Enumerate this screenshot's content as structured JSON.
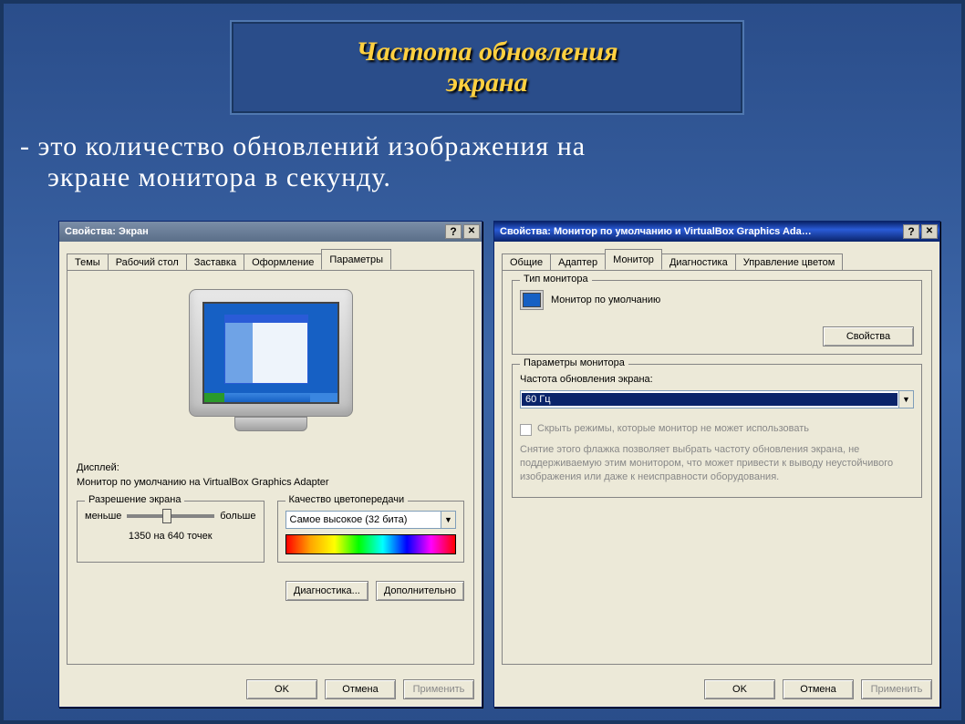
{
  "slide": {
    "title_line1": "Частота обновления",
    "title_line2": "экрана",
    "definition_prefix": "- это количество обновлений изображения на",
    "definition_line2": "экране монитора в секунду."
  },
  "win1": {
    "title": "Свойства: Экран",
    "tabs": [
      "Темы",
      "Рабочий стол",
      "Заставка",
      "Оформление",
      "Параметры"
    ],
    "active_tab": "Параметры",
    "display_label": "Дисплей:",
    "display_value": "Монитор по умолчанию на VirtualBox Graphics Adapter",
    "resolution_group": "Разрешение экрана",
    "res_less": "меньше",
    "res_more": "больше",
    "res_value": "1350 на 640 точек",
    "quality_group": "Качество цветопередачи",
    "quality_value": "Самое высокое (32 бита)",
    "btn_diag": "Диагностика...",
    "btn_more": "Дополнительно",
    "btn_ok": "OK",
    "btn_cancel": "Отмена",
    "btn_apply": "Применить"
  },
  "win2": {
    "title": "Свойства: Монитор по умолчанию и VirtualBox Graphics Ada…",
    "tabs": [
      "Общие",
      "Адаптер",
      "Монитор",
      "Диагностика",
      "Управление цветом"
    ],
    "active_tab": "Монитор",
    "montype_group": "Тип монитора",
    "montype_value": "Монитор по умолчанию",
    "btn_props": "Свойства",
    "monparams_group": "Параметры монитора",
    "freq_label": "Частота обновления экрана:",
    "freq_value": "60 Гц",
    "hide_modes": "Скрыть режимы, которые монитор не может использовать",
    "hint": "Снятие этого флажка позволяет выбрать частоту обновления экрана, не поддерживаемую этим монитором, что может привести к выводу неустойчивого изображения или даже к неисправности оборудования.",
    "btn_ok": "OK",
    "btn_cancel": "Отмена",
    "btn_apply": "Применить"
  }
}
